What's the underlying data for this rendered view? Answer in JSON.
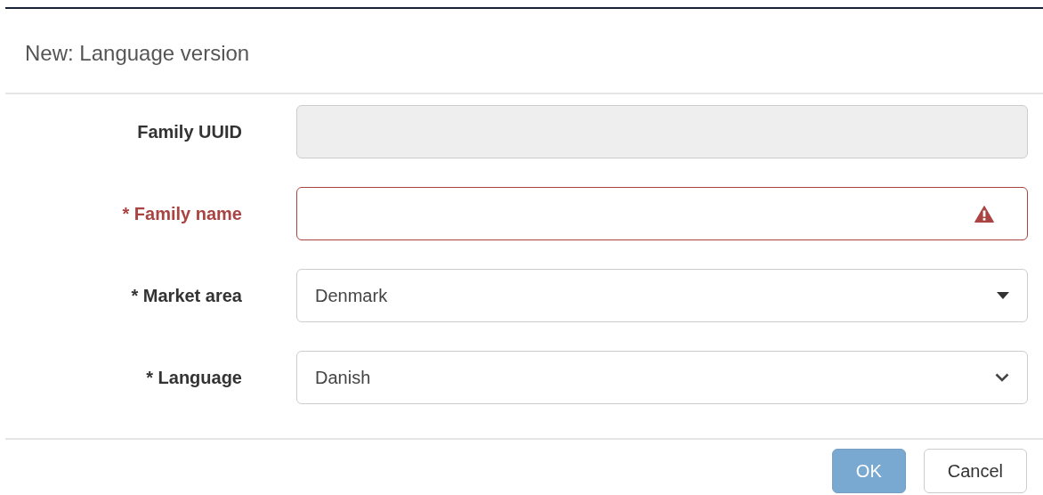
{
  "dialog": {
    "title": "New: Language version"
  },
  "fields": [
    {
      "label": "Family UUID",
      "kind": "text",
      "disabled": true,
      "invalid": false
    },
    {
      "label": "* Family name",
      "kind": "text",
      "disabled": false,
      "invalid": true
    },
    {
      "label": "* Market area",
      "kind": "dropdown",
      "value": "Denmark",
      "disabled": false,
      "invalid": false
    },
    {
      "label": "* Language",
      "kind": "select",
      "value": "Danish",
      "disabled": false,
      "invalid": false
    }
  ],
  "buttons": [
    {
      "label": "OK",
      "kind": "primary",
      "disabled": true
    },
    {
      "label": "Cancel",
      "kind": "secondary",
      "disabled": false
    }
  ]
}
